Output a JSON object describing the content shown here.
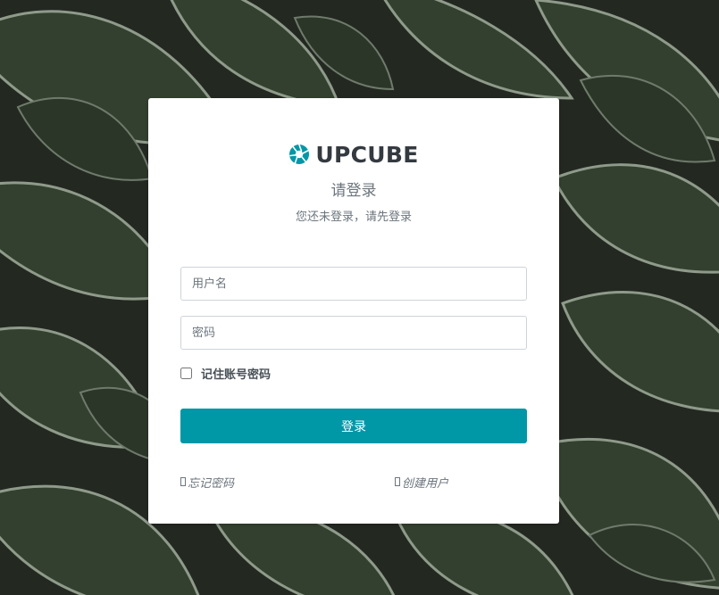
{
  "brand": {
    "name": "UPCUBE",
    "logo_icon": "aperture-icon",
    "icon_color": "#0097a7"
  },
  "login": {
    "title": "请登录",
    "subtitle": "您还未登录，请先登录",
    "username_placeholder": "用户名",
    "username_value": "",
    "password_placeholder": "密码",
    "password_value": "",
    "remember_label": "记住账号密码",
    "remember_checked": false,
    "submit_label": "登录",
    "submit_color": "#0097a7"
  },
  "links": {
    "forgot_label": "忘记密码",
    "forgot_icon": "missing-glyph-icon",
    "create_label": "创建用户",
    "create_icon": "missing-glyph-icon"
  }
}
